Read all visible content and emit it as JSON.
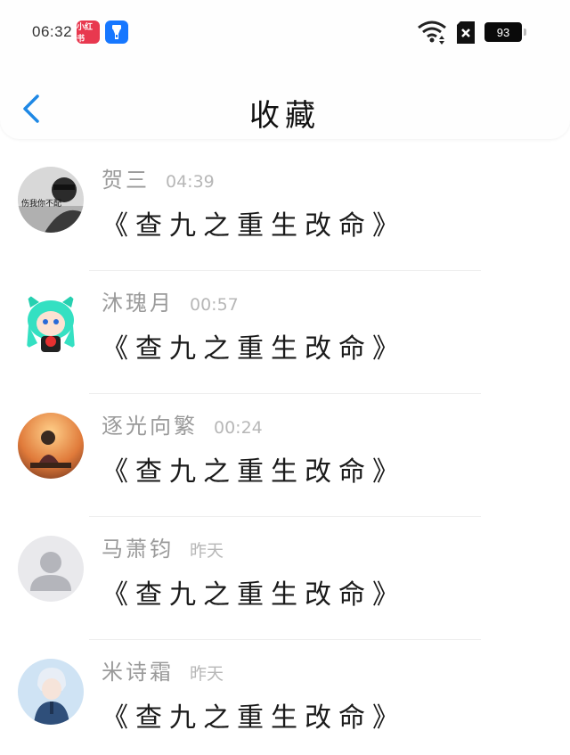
{
  "status_bar": {
    "time": "06:32",
    "app1_label": "小红书",
    "battery": "93"
  },
  "header": {
    "title": "收藏"
  },
  "items": [
    {
      "name": "贺三",
      "time": "04:39",
      "book": "《查九之重生改命》",
      "avatar_badge": "伤我你不配"
    },
    {
      "name": "沐瑰月",
      "time": "00:57",
      "book": "《查九之重生改命》"
    },
    {
      "name": "逐光向繁",
      "time": "00:24",
      "book": "《查九之重生改命》"
    },
    {
      "name": "马萧钧",
      "time": "昨天",
      "book": "《查九之重生改命》"
    },
    {
      "name": "米诗霜",
      "time": "昨天",
      "book": "《查九之重生改命》"
    }
  ],
  "colors": {
    "accent": "#1e88e5",
    "app_red": "#e8384f",
    "app_blue": "#1677ff"
  }
}
